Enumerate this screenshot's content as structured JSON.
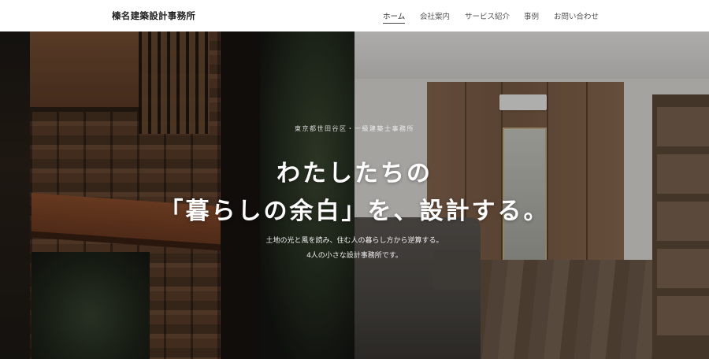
{
  "header": {
    "logo": "榛名建築設計事務所",
    "nav": [
      {
        "label": "ホーム",
        "active": true
      },
      {
        "label": "会社案内"
      },
      {
        "label": "サービス紹介"
      },
      {
        "label": "事例"
      },
      {
        "label": "お問い合わせ"
      }
    ]
  },
  "hero": {
    "sub_label": "東京都世田谷区・一級建築士事務所",
    "headline_line1": "わたしたちの",
    "headline_line2": "「暮らしの余白」を、設計する。",
    "description_line1": "土地の光と風を読み、住む人の暮らし方から逆算する。",
    "description_line2": "4人の小さな設計事務所です。"
  }
}
